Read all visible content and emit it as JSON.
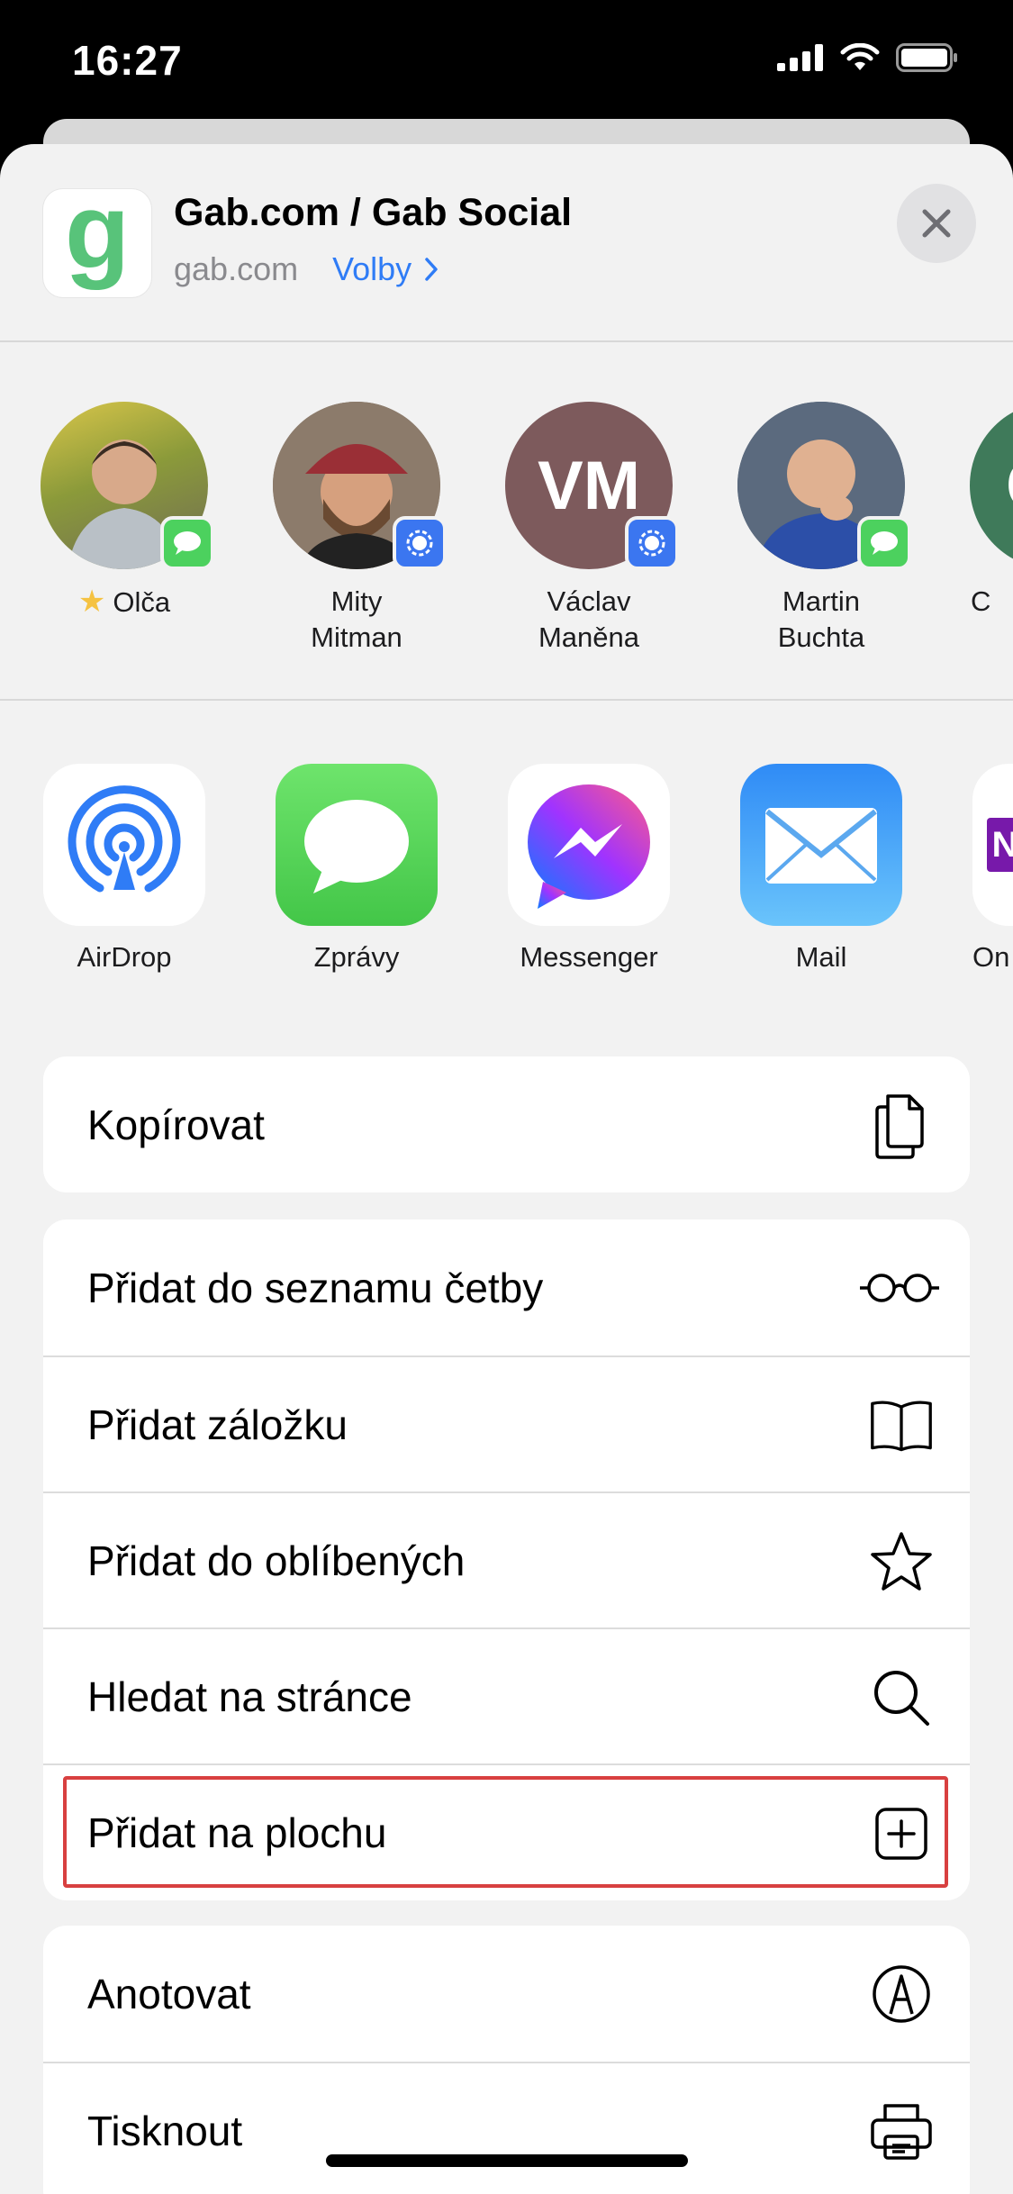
{
  "status_bar": {
    "time": "16:27"
  },
  "header": {
    "icon_letter": "g",
    "title": "Gab.com / Gab Social",
    "domain": "gab.com",
    "options_label": "Volby"
  },
  "contacts": [
    {
      "name": "Olča",
      "initials": "",
      "badge": "message"
    },
    {
      "name": "Mity\nMitman",
      "initials": "",
      "badge": "signal"
    },
    {
      "name": "Václav\nManěna",
      "initials": "VM",
      "badge": "signal"
    },
    {
      "name": "Martin\nBuchta",
      "initials": "",
      "badge": "message"
    },
    {
      "name": "C",
      "initials": "C",
      "badge": ""
    }
  ],
  "apps": [
    {
      "label": "AirDrop"
    },
    {
      "label": "Zprávy"
    },
    {
      "label": "Messenger"
    },
    {
      "label": "Mail"
    },
    {
      "label": "On"
    }
  ],
  "actions_group1": [
    {
      "label": "Kopírovat",
      "icon": "copy-icon"
    }
  ],
  "actions_group2": [
    {
      "label": "Přidat do seznamu četby",
      "icon": "glasses-icon"
    },
    {
      "label": "Přidat záložku",
      "icon": "book-icon"
    },
    {
      "label": "Přidat do oblíbených",
      "icon": "star-icon"
    },
    {
      "label": "Hledat na stránce",
      "icon": "search-icon"
    },
    {
      "label": "Přidat na plochu",
      "icon": "add-square-icon"
    }
  ],
  "actions_group3": [
    {
      "label": "Anotovat",
      "icon": "markup-icon"
    },
    {
      "label": "Tisknout",
      "icon": "printer-icon"
    }
  ],
  "colors": {
    "accent": "#2f7cf6",
    "highlight": "#d84040",
    "gab_green": "#58c37a"
  }
}
